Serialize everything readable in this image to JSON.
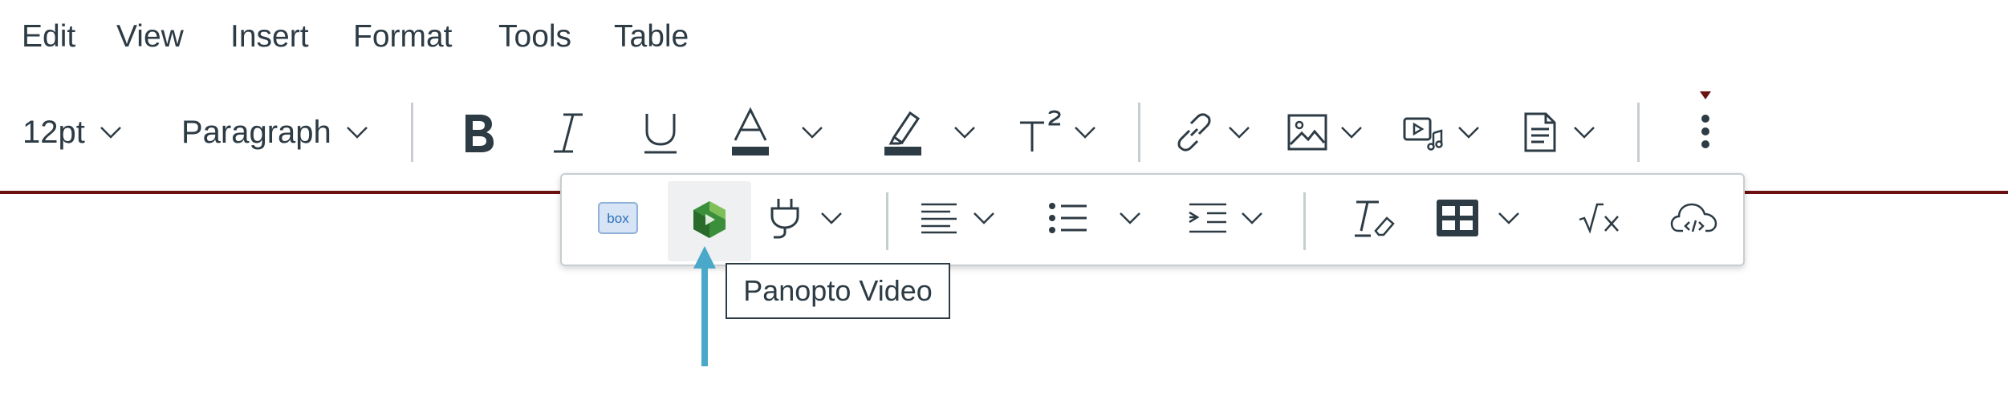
{
  "menubar": {
    "items": [
      "Edit",
      "View",
      "Insert",
      "Format",
      "Tools",
      "Table"
    ]
  },
  "toolbar": {
    "font_size": "12pt",
    "block_format": "Paragraph",
    "icons": {
      "bold": "bold-icon",
      "italic": "italic-icon",
      "underline": "underline-icon",
      "text_color": "text-color-icon",
      "highlight": "highlight-color-icon",
      "superscript": "superscript-icon",
      "link": "link-icon",
      "image": "image-icon",
      "media": "media-icon",
      "document": "document-icon",
      "more": "more-vertical-icon"
    },
    "colors": {
      "accent_line": "#6b0f0f",
      "text": "#2d3b45",
      "separator": "#c7cdd1"
    }
  },
  "overflow_toolbar": {
    "icons": [
      "box-icon",
      "panopto-icon",
      "plug-icon",
      "align-left-icon",
      "bullet-list-icon",
      "indent-icon",
      "clear-formatting-icon",
      "table-icon",
      "math-equation-icon",
      "cloud-embed-icon"
    ]
  },
  "tooltip": {
    "text": "Panopto Video"
  },
  "annotation": {
    "arrow_color": "#4aa8c9"
  }
}
